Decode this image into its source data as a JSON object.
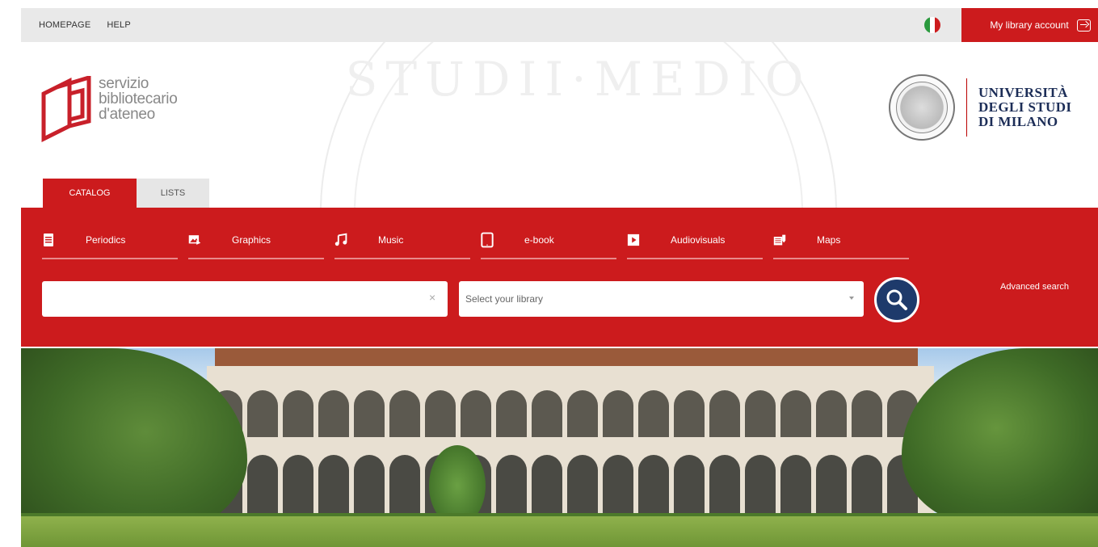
{
  "topbar": {
    "links": [
      "HOMEPAGE",
      "HELP"
    ],
    "account_label": "My library account",
    "flag": {
      "colors": [
        "#2b9a3e",
        "#ffffff",
        "#cc1b1d"
      ]
    }
  },
  "logo": {
    "lines": [
      "servizio",
      "bibliotecario",
      "d'ateneo"
    ]
  },
  "university": {
    "lines": [
      "UNIVERSITÀ",
      "DEGLI STUDI",
      "DI MILANO"
    ]
  },
  "tabs": [
    {
      "label": "CATALOG",
      "active": true
    },
    {
      "label": "LISTS",
      "active": false
    }
  ],
  "categories": [
    {
      "label": "Periodics",
      "icon": "periodical-icon"
    },
    {
      "label": "Graphics",
      "icon": "image-icon"
    },
    {
      "label": "Music",
      "icon": "music-note-icon"
    },
    {
      "label": "e-book",
      "icon": "tablet-icon"
    },
    {
      "label": "Audiovisuals",
      "icon": "film-icon"
    },
    {
      "label": "Maps",
      "icon": "map-icon"
    }
  ],
  "search": {
    "value": "",
    "placeholder": "",
    "clear_label": "×",
    "library_select": "Select your library",
    "advanced_label": "Advanced search"
  },
  "colors": {
    "brand_red": "#cc1b1d",
    "search_button": "#1e3a6b",
    "university_blue": "#1c2d57"
  }
}
